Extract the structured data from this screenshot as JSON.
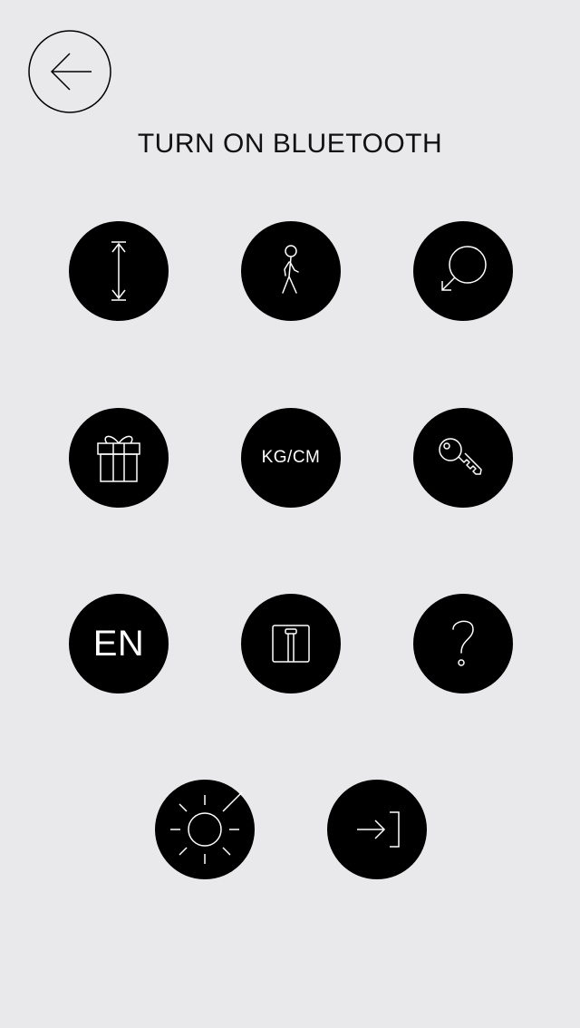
{
  "header": {
    "title": "TURN ON BLUETOOTH"
  },
  "buttons": {
    "units_label": "KG/CM",
    "language_label": "EN"
  },
  "icons": {
    "back": "arrow-left-circle-icon",
    "height": "vertical-double-arrow-icon",
    "walking": "walking-person-icon",
    "search": "search-refresh-icon",
    "gift": "gift-icon",
    "key": "key-icon",
    "scale": "bathroom-scale-icon",
    "help": "question-mark-icon",
    "brightness": "sun-brightness-icon",
    "login": "sign-in-arrow-icon"
  },
  "colors": {
    "background": "#e9e9eb",
    "button": "#000000",
    "icon": "#ffffff"
  }
}
